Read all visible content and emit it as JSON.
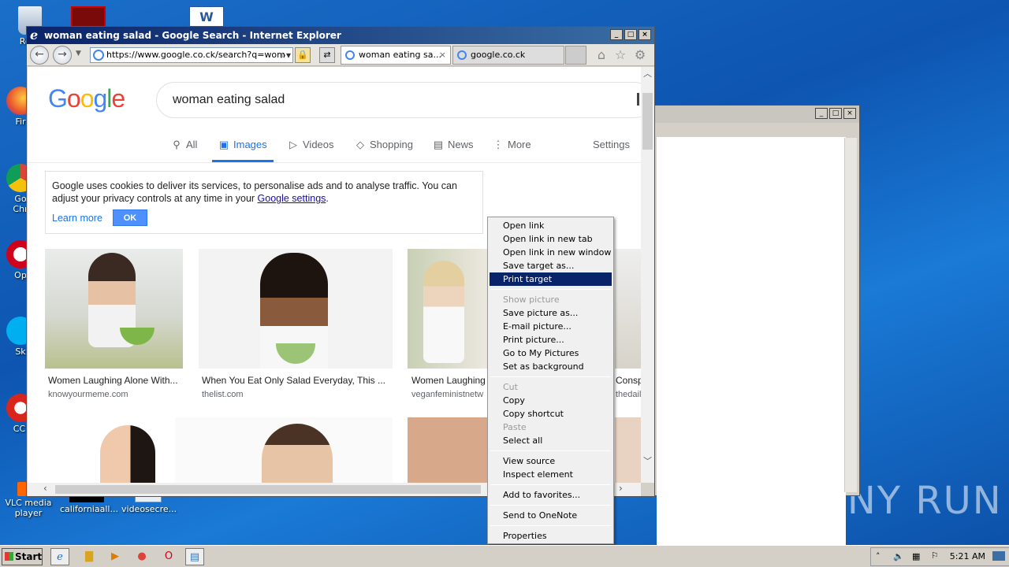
{
  "desktop": {
    "icons": [
      {
        "label": "Recy",
        "name": "recycle-bin-icon"
      },
      {
        "label": "Fir",
        "name": "firefox-icon"
      },
      {
        "label": "Go\nChr",
        "name": "chrome-icon"
      },
      {
        "label": "Op",
        "name": "opera-icon"
      },
      {
        "label": "Sk",
        "name": "skype-icon"
      },
      {
        "label": "CCl",
        "name": "ccleaner-icon"
      },
      {
        "label": "VLC media player",
        "name": "vlc-icon"
      },
      {
        "label": "californiaall...",
        "name": "file-icon"
      },
      {
        "label": "videosecre...",
        "name": "file-icon"
      }
    ],
    "watermark": "ANY RUN"
  },
  "ie": {
    "title": "woman eating salad - Google Search - Internet Explorer",
    "address": "https://www.google.co.ck/search?q=wom",
    "tabs": [
      {
        "label": "woman eating sa...",
        "active": true
      },
      {
        "label": "google.co.ck",
        "active": false
      }
    ]
  },
  "google": {
    "logo": "Google",
    "query": "woman eating salad",
    "nav": {
      "all": "All",
      "images": "Images",
      "videos": "Videos",
      "shopping": "Shopping",
      "news": "News",
      "more": "More",
      "settings": "Settings"
    },
    "cookie": {
      "text": "Google uses cookies to deliver its services, to personalise ads and to analyse traffic. You can adjust your privacy controls at any time in your ",
      "link": "Google settings",
      "end": ".",
      "learn_more": "Learn more",
      "ok": "OK"
    },
    "results": [
      {
        "caption": "Women Laughing Alone With...",
        "source": "knowyourmeme.com"
      },
      {
        "caption": "When You Eat Only Salad Everyday, This ...",
        "source": "thelist.com"
      },
      {
        "caption": "Women Laughing",
        "source": "veganfeministnetw"
      },
      {
        "caption": "Consp",
        "source": "thedail"
      }
    ]
  },
  "context_menu": {
    "items": [
      {
        "label": "Open link",
        "disabled": false
      },
      {
        "label": "Open link in new tab",
        "disabled": false
      },
      {
        "label": "Open link in new window",
        "disabled": false
      },
      {
        "label": "Save target as...",
        "disabled": false
      },
      {
        "label": "Print target",
        "disabled": false,
        "selected": true
      },
      {
        "label": "Show picture",
        "disabled": true
      },
      {
        "label": "Save picture as...",
        "disabled": false
      },
      {
        "label": "E-mail picture...",
        "disabled": false
      },
      {
        "label": "Print picture...",
        "disabled": false
      },
      {
        "label": "Go to My Pictures",
        "disabled": false
      },
      {
        "label": "Set as background",
        "disabled": false
      },
      {
        "label": "Cut",
        "disabled": true
      },
      {
        "label": "Copy",
        "disabled": false
      },
      {
        "label": "Copy shortcut",
        "disabled": false
      },
      {
        "label": "Paste",
        "disabled": true
      },
      {
        "label": "Select all",
        "disabled": false
      },
      {
        "label": "View source",
        "disabled": false
      },
      {
        "label": "Inspect element",
        "disabled": false
      },
      {
        "label": "Add to favorites...",
        "disabled": false
      },
      {
        "label": "Send to OneNote",
        "disabled": false
      },
      {
        "label": "Properties",
        "disabled": false
      }
    ]
  },
  "taskbar": {
    "start": "Start",
    "clock": "5:21 AM"
  }
}
